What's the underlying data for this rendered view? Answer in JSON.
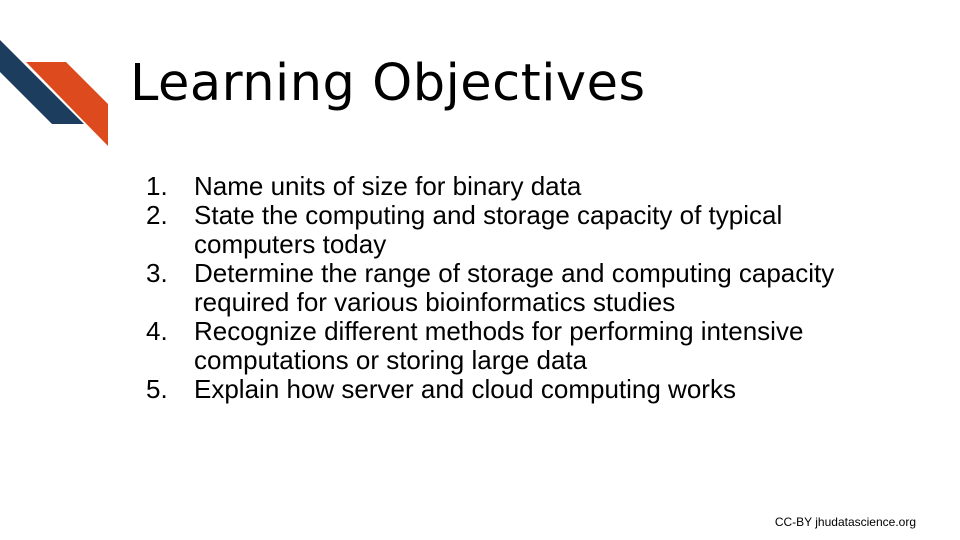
{
  "slide": {
    "title": "Learning Objectives",
    "objectives": [
      {
        "num": "1.",
        "text": "Name units of size for binary data"
      },
      {
        "num": "2.",
        "text": "State the computing and storage capacity of typical computers today"
      },
      {
        "num": "3.",
        "text": "Determine the range of storage and computing capacity required for various bioinformatics studies"
      },
      {
        "num": "4.",
        "text": "Recognize different methods for performing intensive computations or storing large data"
      },
      {
        "num": "5.",
        "text": "Explain how server and cloud computing works"
      }
    ],
    "footer": "CC-BY jhudatascience.org"
  },
  "colors": {
    "navy": "#1c3d5e",
    "orange": "#dc4a1e",
    "text": "#000000"
  },
  "icons": {
    "logo": "diagonal-stripes-logo"
  }
}
